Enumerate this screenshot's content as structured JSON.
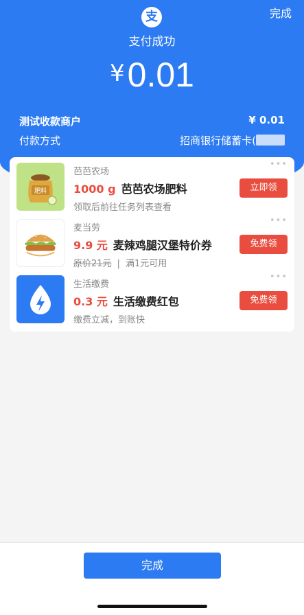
{
  "header": {
    "done_label": "完成",
    "logo_glyph": "支",
    "title": "支付成功",
    "currency": "¥",
    "amount": "0.01"
  },
  "details": {
    "merchant_label": "测试收款商户",
    "merchant_amount": "¥ 0.01",
    "method_label": "付款方式",
    "method_value": "招商银行储蓄卡("
  },
  "offers": [
    {
      "merchant": "芭芭农场",
      "price": "1000 g",
      "name": "芭芭农场肥料",
      "sub": "领取后前往任务列表查看",
      "button": "立即领",
      "thumb_text": "肥料",
      "icon": "fertilizer-bag-icon"
    },
    {
      "merchant": "麦当劳",
      "price": "9.9 元",
      "name": "麦辣鸡腿汉堡特价券",
      "sub_strike": "原价21元",
      "sub_sep": "|",
      "sub": "满1元可用",
      "button": "免费领",
      "icon": "burger-icon"
    },
    {
      "merchant": "生活缴费",
      "price": "0.3 元",
      "name": "生活缴费红包",
      "sub": "缴费立减，到账快",
      "button": "免费领",
      "icon": "lightning-drop-icon"
    }
  ],
  "more_dots": "•••",
  "footer": {
    "done_label": "完成"
  },
  "colors": {
    "brand_blue": "#2c7bf3",
    "offer_red": "#e94d3f",
    "background": "#f4f4f5"
  }
}
